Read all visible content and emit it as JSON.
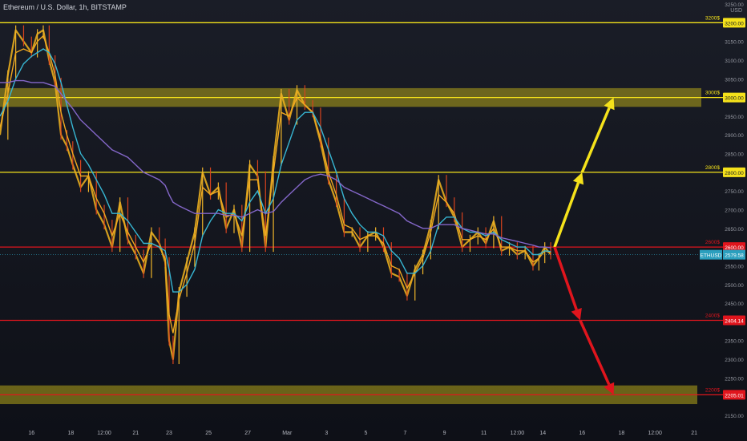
{
  "header": {
    "symbol_title": "Ethereum / U.S. Dollar, 1h, BITSTAMP",
    "currency": "USD"
  },
  "colors": {
    "background": "#131722",
    "zone": "#b5a51a",
    "yellow": "#f5e21b",
    "red": "#e0151d",
    "price": "#e8ad1e",
    "ema_fast": "#f0a820",
    "ema_mid": "#37b6d3",
    "ema_slow": "#8467c9",
    "price_label_bg": "#2b9fbe"
  },
  "chart_data": {
    "type": "line",
    "title": "Ethereum / U.S. Dollar, 1h, BITSTAMP",
    "ylabel": "USD",
    "ylim": [
      2130,
      3300
    ],
    "y_ticks": [
      3250,
      3150,
      3100,
      3050,
      2950,
      2900,
      2850,
      2750,
      2700,
      2650,
      2550,
      2500,
      2450,
      2350,
      2300,
      2250,
      2150
    ],
    "y_tick_labels": [
      "3250.00",
      "3150.00",
      "3100.00",
      "3050.00",
      "2950.00",
      "2900.00",
      "2850.00",
      "2750.00",
      "2700.00",
      "2650.00",
      "2550.00",
      "2500.00",
      "2450.00",
      "2350.00",
      "2300.00",
      "2250.00",
      "2150.00"
    ],
    "x_tick_labels": [
      "16",
      "18",
      "12:00",
      "21",
      "23",
      "25",
      "27",
      "Mar",
      "3",
      "5",
      "7",
      "9",
      "11",
      "12:00",
      "14",
      "16",
      "18",
      "12:00",
      "21"
    ],
    "x_tick_index": [
      0,
      2,
      3.7,
      5.3,
      7,
      9,
      11,
      13,
      15,
      17,
      19,
      21,
      23,
      24.7,
      26,
      28,
      30,
      31.7,
      33.7
    ],
    "x_index_range": [
      -1.6,
      34.1
    ],
    "horizontal_levels": [
      {
        "value": 3200,
        "label": "3200$",
        "price_label": "3200.00",
        "color": "yellow"
      },
      {
        "value": 3000,
        "label": "3000$",
        "price_label": "3000.00",
        "color": "yellow"
      },
      {
        "value": 2800,
        "label": "2800$",
        "price_label": "2800.00",
        "color": "yellow"
      },
      {
        "value": 2600,
        "label": "2600$",
        "price_label": "2600.00",
        "color": "red"
      },
      {
        "value": 2404.14,
        "label": "2400$",
        "price_label": "2404.14",
        "color": "red"
      },
      {
        "value": 2205.01,
        "label": "2200$",
        "price_label": "2205.01",
        "color": "red"
      }
    ],
    "zones": [
      {
        "low": 2975,
        "high": 3025
      },
      {
        "low": 2180,
        "high": 2230
      }
    ],
    "current_price": {
      "symbol": "ETHUSD",
      "value": 2579.58,
      "label": "2579.58"
    },
    "price_series": {
      "x": [
        -1.6,
        -1.2,
        -0.8,
        -0.4,
        0,
        0.3,
        0.6,
        0.9,
        1.2,
        1.5,
        1.8,
        2.1,
        2.5,
        2.9,
        3.3,
        3.7,
        4.1,
        4.5,
        4.9,
        5.3,
        5.7,
        6.1,
        6.5,
        6.8,
        7.0,
        7.2,
        7.5,
        7.9,
        8.3,
        8.7,
        9.1,
        9.5,
        9.9,
        10.3,
        10.7,
        11.1,
        11.5,
        11.9,
        12.3,
        12.7,
        13.1,
        13.5,
        13.9,
        14.3,
        14.7,
        15.1,
        15.5,
        15.9,
        16.3,
        16.7,
        17.1,
        17.5,
        17.9,
        18.3,
        18.7,
        19.1,
        19.5,
        19.9,
        20.3,
        20.7,
        21.1,
        21.5,
        21.9,
        22.3,
        22.7,
        23.1,
        23.5,
        23.9,
        24.3,
        24.7,
        25.1,
        25.5,
        25.8,
        26.1,
        26.4
      ],
      "y": [
        2900,
        3060,
        3180,
        3150,
        3120,
        3170,
        3180,
        3100,
        3040,
        2900,
        2870,
        2820,
        2760,
        2790,
        2700,
        2660,
        2600,
        2720,
        2620,
        2580,
        2530,
        2640,
        2610,
        2560,
        2350,
        2300,
        2480,
        2560,
        2640,
        2800,
        2740,
        2760,
        2650,
        2700,
        2600,
        2820,
        2790,
        2600,
        2830,
        3010,
        2940,
        3020,
        2980,
        2960,
        2880,
        2780,
        2720,
        2640,
        2640,
        2600,
        2630,
        2640,
        2600,
        2530,
        2520,
        2470,
        2540,
        2580,
        2660,
        2780,
        2720,
        2680,
        2600,
        2620,
        2640,
        2610,
        2670,
        2590,
        2600,
        2580,
        2590,
        2550,
        2570,
        2600,
        2580
      ]
    },
    "series": [
      {
        "key": "ema_fast",
        "values": [
          2920,
          3010,
          3120,
          3130,
          3120,
          3150,
          3165,
          3120,
          3060,
          2960,
          2900,
          2850,
          2790,
          2790,
          2730,
          2690,
          2630,
          2690,
          2640,
          2600,
          2560,
          2610,
          2600,
          2570,
          2420,
          2370,
          2460,
          2530,
          2610,
          2760,
          2740,
          2750,
          2680,
          2690,
          2630,
          2780,
          2780,
          2630,
          2800,
          2960,
          2950,
          3000,
          2980,
          2960,
          2890,
          2800,
          2740,
          2660,
          2650,
          2620,
          2630,
          2630,
          2610,
          2550,
          2540,
          2490,
          2530,
          2570,
          2640,
          2740,
          2720,
          2690,
          2620,
          2620,
          2630,
          2620,
          2650,
          2600,
          2600,
          2590,
          2590,
          2560,
          2570,
          2590,
          2585
        ]
      },
      {
        "key": "ema_mid",
        "values": [
          2950,
          2990,
          3050,
          3090,
          3110,
          3120,
          3130,
          3120,
          3090,
          3040,
          2980,
          2920,
          2850,
          2820,
          2780,
          2740,
          2690,
          2690,
          2670,
          2640,
          2610,
          2610,
          2600,
          2590,
          2540,
          2480,
          2480,
          2500,
          2540,
          2630,
          2670,
          2700,
          2690,
          2690,
          2670,
          2720,
          2750,
          2690,
          2730,
          2820,
          2880,
          2940,
          2960,
          2960,
          2920,
          2860,
          2800,
          2730,
          2690,
          2660,
          2640,
          2640,
          2630,
          2590,
          2570,
          2530,
          2530,
          2550,
          2590,
          2660,
          2680,
          2680,
          2650,
          2640,
          2640,
          2630,
          2640,
          2620,
          2610,
          2600,
          2600,
          2580,
          2580,
          2590,
          2588
        ]
      },
      {
        "key": "ema_slow",
        "values": [
          3040,
          3040,
          3045,
          3045,
          3040,
          3040,
          3040,
          3035,
          3030,
          3010,
          2990,
          2970,
          2940,
          2920,
          2900,
          2880,
          2860,
          2850,
          2840,
          2820,
          2800,
          2790,
          2780,
          2765,
          2740,
          2720,
          2710,
          2700,
          2690,
          2690,
          2690,
          2690,
          2685,
          2685,
          2680,
          2690,
          2700,
          2690,
          2695,
          2720,
          2740,
          2760,
          2780,
          2790,
          2795,
          2790,
          2780,
          2760,
          2750,
          2740,
          2730,
          2720,
          2710,
          2700,
          2690,
          2670,
          2660,
          2650,
          2650,
          2660,
          2660,
          2660,
          2650,
          2645,
          2640,
          2635,
          2635,
          2625,
          2620,
          2615,
          2610,
          2605,
          2600,
          2600,
          2598
        ]
      }
    ],
    "projection_arrows": [
      {
        "color": "yellow",
        "from": [
          26.6,
          2600
        ],
        "to": [
          28.0,
          2800
        ]
      },
      {
        "color": "yellow",
        "from": [
          28.0,
          2800
        ],
        "to": [
          29.6,
          3000
        ]
      },
      {
        "color": "red",
        "from": [
          26.6,
          2600
        ],
        "to": [
          27.9,
          2404.14
        ]
      },
      {
        "color": "red",
        "from": [
          27.9,
          2404.14
        ],
        "to": [
          29.6,
          2205.01
        ]
      }
    ]
  }
}
